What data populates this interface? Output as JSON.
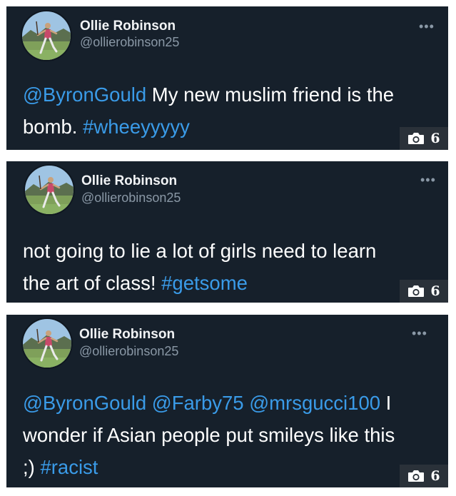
{
  "tweets": [
    {
      "name": "Ollie Robinson",
      "handle": "@ollierobinson25",
      "more_label": "•••",
      "lines": [
        [
          {
            "text": "@ByronGould",
            "link": true
          },
          {
            "text": "  My new muslim friend is the",
            "link": false
          }
        ],
        [
          {
            "text": "bomb. ",
            "link": false
          },
          {
            "text": "#wheeyyyyy",
            "link": true
          }
        ]
      ],
      "photo_count": "6"
    },
    {
      "name": "Ollie Robinson",
      "handle": "@ollierobinson25",
      "more_label": "•••",
      "lines": [
        [
          {
            "text": "not going to lie a lot of girls need to learn",
            "link": false
          }
        ],
        [
          {
            "text": "the art of class! ",
            "link": false
          },
          {
            "text": "#getsome",
            "link": true
          }
        ]
      ],
      "photo_count": "6"
    },
    {
      "name": "Ollie Robinson",
      "handle": "@ollierobinson25",
      "more_label": "•••",
      "lines": [
        [
          {
            "text": "@ByronGould",
            "link": true
          },
          {
            "text": " ",
            "link": false
          },
          {
            "text": "@Farby75",
            "link": true
          },
          {
            "text": " ",
            "link": false
          },
          {
            "text": "@mrsgucci100",
            "link": true
          },
          {
            "text": "  I",
            "link": false
          }
        ],
        [
          {
            "text": "wonder if Asian people put smileys like this",
            "link": false
          }
        ],
        [
          {
            "text": ";) ",
            "link": false
          },
          {
            "text": "#racist",
            "link": true
          }
        ]
      ],
      "photo_count": "6"
    }
  ],
  "colors": {
    "card_bg": "#16202b",
    "link": "#3a9be8",
    "handle": "#8a98a6",
    "badge_bg": "#2a3139"
  },
  "icons": {
    "more": "more-options-icon",
    "camera": "camera-icon"
  }
}
